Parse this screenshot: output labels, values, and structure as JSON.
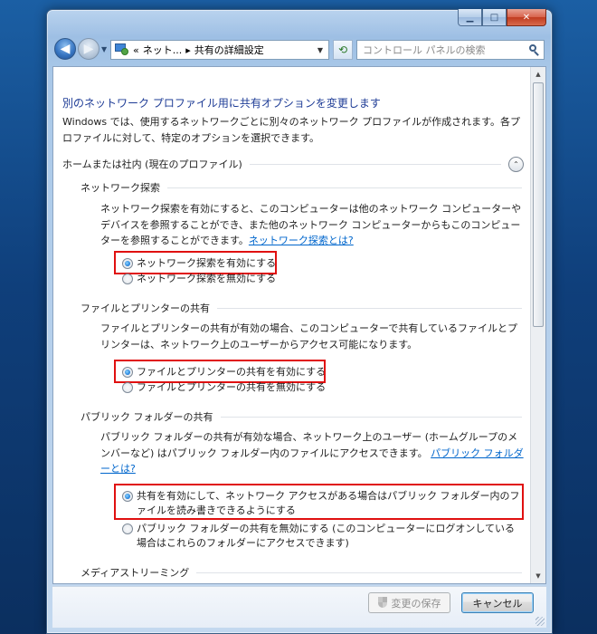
{
  "window": {
    "caption_min": "▁",
    "caption_max": "□",
    "caption_close": "✕"
  },
  "nav": {
    "back_glyph": "◀",
    "forward_glyph": "▶",
    "dropdown_glyph": "▼",
    "address_prefix": "«",
    "breadcrumb_1": "ネット...",
    "breadcrumb_sep": "▸",
    "breadcrumb_2": "共有の詳細設定",
    "address_dropdown": "▼",
    "refresh_glyph": "⟲",
    "search_placeholder": "コントロール パネルの検索"
  },
  "content": {
    "title": "別のネットワーク プロファイル用に共有オプションを変更します",
    "intro": "Windows では、使用するネットワークごとに別々のネットワーク プロファイルが作成されます。各プロファイルに対して、特定のオプションを選択できます。",
    "profile_header": "ホームまたは社内 (現在のプロファイル)",
    "collapse_glyph": "⌃",
    "sections": [
      {
        "title": "ネットワーク探索",
        "description": "ネットワーク探索を有効にすると、このコンピューターは他のネットワーク コンピューターやデバイスを参照することができ、また他のネットワーク コンピューターからもこのコンピューターを参照することができます。",
        "link": "ネットワーク探索とは?",
        "options": [
          {
            "label": "ネットワーク探索を有効にする",
            "selected": true
          },
          {
            "label": "ネットワーク探索を無効にする",
            "selected": false
          }
        ]
      },
      {
        "title": "ファイルとプリンターの共有",
        "description": "ファイルとプリンターの共有が有効の場合、このコンピューターで共有しているファイルとプリンターは、ネットワーク上のユーザーからアクセス可能になります。",
        "options": [
          {
            "label": "ファイルとプリンターの共有を有効にする",
            "selected": true
          },
          {
            "label": "ファイルとプリンターの共有を無効にする",
            "selected": false
          }
        ]
      },
      {
        "title": "パブリック フォルダーの共有",
        "description": "パブリック フォルダーの共有が有効な場合、ネットワーク上のユーザー (ホームグループのメンバーなど) はパブリック フォルダー内のファイルにアクセスできます。",
        "link": "パブリック フォルダーとは?",
        "options": [
          {
            "label": "共有を有効にして、ネットワーク アクセスがある場合はパブリック フォルダー内のファイルを読み書きできるようにする",
            "selected": true
          },
          {
            "label": "パブリック フォルダーの共有を無効にする (このコンピューターにログオンしている場合はこれらのフォルダーにアクセスできます)",
            "selected": false
          }
        ]
      },
      {
        "title": "メディアストリーミング"
      }
    ]
  },
  "footer": {
    "save_label": "変更の保存",
    "cancel_label": "キャンセル"
  },
  "colors": {
    "highlight": "#e01010",
    "link": "#0066cc",
    "title": "#1e3c96"
  }
}
